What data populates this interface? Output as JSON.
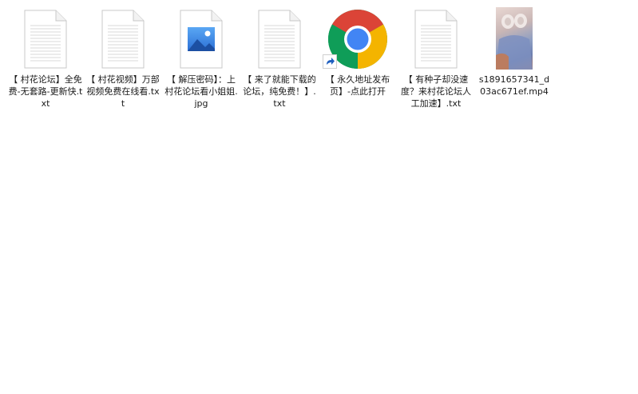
{
  "files": [
    {
      "type": "txt",
      "name": "【 村花论坛】全免费-无套路-更新快.txt"
    },
    {
      "type": "txt",
      "name": "【 村花视频】万部视频免费在线看.txt"
    },
    {
      "type": "jpg",
      "name": "【 解压密码】：上村花论坛看小姐姐.jpg"
    },
    {
      "type": "txt",
      "name": "【 来了就能下载的论坛，纯免费！】.txt"
    },
    {
      "type": "url",
      "name": "【 永久地址发布页】-点此打开",
      "icon": "chrome-icon",
      "shortcut": true
    },
    {
      "type": "txt",
      "name": "【 有种子却没速度？来村花论坛人工加速】.txt"
    },
    {
      "type": "mp4",
      "name": "s1891657341_d03ac671ef.mp4"
    }
  ],
  "colors": {
    "background": "#ffffff",
    "doc_lines": "#d9d9d9",
    "image_blue": "#2b6fd6",
    "chrome_red": "#db4437",
    "chrome_green": "#0f9d58",
    "chrome_yellow": "#f4b400",
    "chrome_blue": "#4285f4"
  }
}
